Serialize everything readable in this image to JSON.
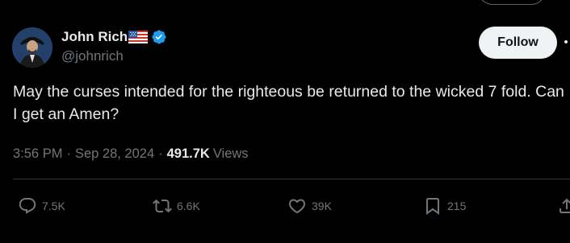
{
  "author": {
    "display_name": "John Rich",
    "handle": "@johnrich",
    "flag_icon": "us-flag-icon",
    "verified_icon": "verified-badge-icon",
    "verified_color": "#1d9bf0"
  },
  "follow_button": {
    "label": "Follow"
  },
  "tweet": {
    "text": "May the curses intended for the righteous be returned to the wicked 7 fold. Can I get an Amen?"
  },
  "meta": {
    "time": "3:56 PM",
    "separator": "·",
    "date": "Sep 28, 2024",
    "views_count": "491.7K",
    "views_label": "Views"
  },
  "actions": {
    "replies": "7.5K",
    "reposts": "6.6K",
    "likes": "39K",
    "bookmarks": "215"
  },
  "colors": {
    "background": "#000000",
    "text": "#e7e9ea",
    "muted": "#71767b",
    "divider": "#2f3336"
  }
}
